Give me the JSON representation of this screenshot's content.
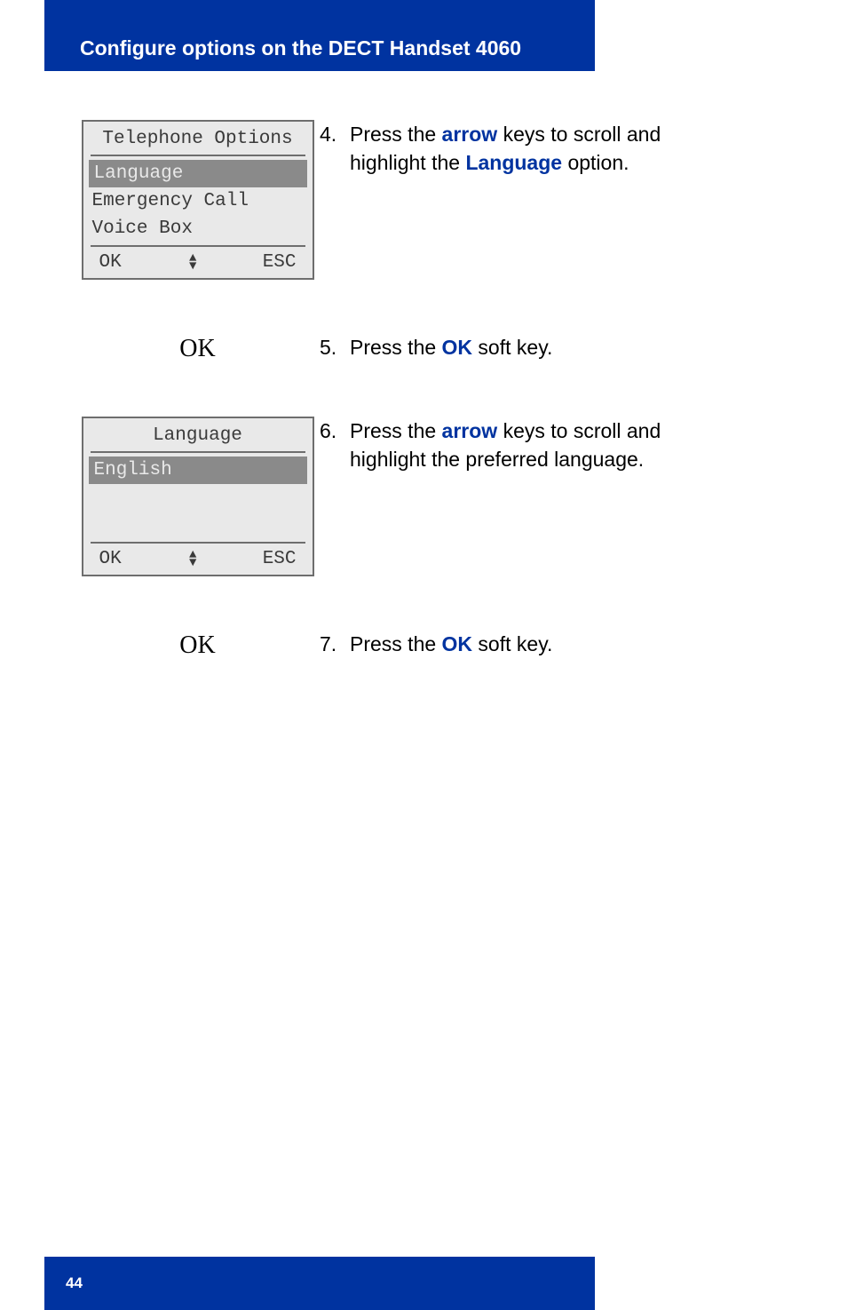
{
  "header": {
    "title": "Configure options on the DECT Handset 4060"
  },
  "footer": {
    "page": "44"
  },
  "labels": {
    "ok": "OK"
  },
  "steps": {
    "s4": {
      "num": "4.",
      "pre": "Press the ",
      "kw1": "arrow",
      "mid": " keys to scroll and highlight the ",
      "kw2": "Language",
      "post": " option."
    },
    "s5": {
      "num": "5.",
      "pre": "Press the ",
      "kw1": "OK",
      "post": " soft key."
    },
    "s6": {
      "num": "6.",
      "pre": "Press the ",
      "kw1": "arrow",
      "post": " keys to scroll and highlight the preferred language."
    },
    "s7": {
      "num": "7.",
      "pre": "Press the ",
      "kw1": "OK",
      "post": " soft key."
    }
  },
  "phone1": {
    "title": "Telephone Options",
    "items": [
      "Language",
      "Emergency Call",
      "Voice Box"
    ],
    "selected_index": 0,
    "softkeys": {
      "left": "OK",
      "right": "ESC"
    }
  },
  "phone2": {
    "title": "Language",
    "items": [
      "English"
    ],
    "selected_index": 0,
    "softkeys": {
      "left": "OK",
      "right": "ESC"
    }
  }
}
